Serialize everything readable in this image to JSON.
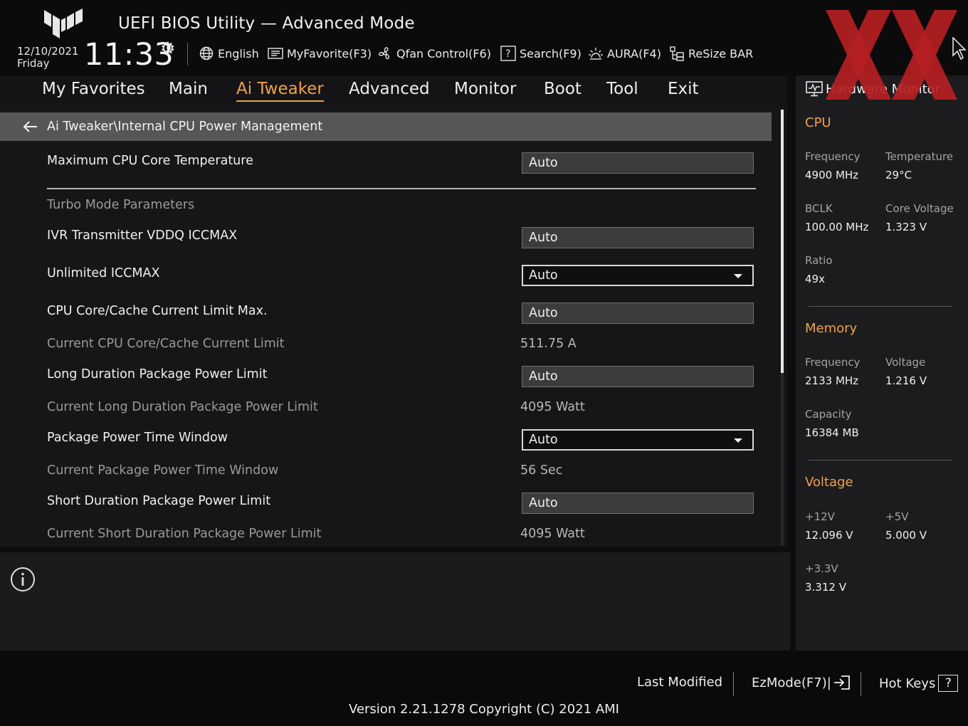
{
  "header": {
    "title": "UEFI BIOS Utility — Advanced Mode",
    "date": "12/10/2021",
    "day": "Friday",
    "time": "11:33",
    "toolbar": {
      "language": "English",
      "myfavorite": "MyFavorite(F3)",
      "qfan": "Qfan Control(F6)",
      "search": "Search(F9)",
      "aura": "AURA(F4)",
      "resizebar": "ReSize BAR"
    }
  },
  "nav": {
    "tabs": [
      "My Favorites",
      "Main",
      "Ai Tweaker",
      "Advanced",
      "Monitor",
      "Boot",
      "Tool",
      "Exit"
    ],
    "active": "Ai Tweaker"
  },
  "main": {
    "breadcrumb": "Ai Tweaker\\Internal CPU Power Management",
    "max_temp": {
      "label": "Maximum CPU Core Temperature",
      "value": "Auto"
    },
    "section_title": "Turbo Mode Parameters",
    "ivr": {
      "label": "IVR Transmitter VDDQ ICCMAX",
      "value": "Auto"
    },
    "unlimited_iccmax": {
      "label": "Unlimited ICCMAX",
      "value": "Auto"
    },
    "core_cache_limit": {
      "label": "CPU Core/Cache Current Limit Max.",
      "value": "Auto"
    },
    "current_core_cache_limit": {
      "label": "Current CPU Core/Cache Current Limit",
      "value": "511.75 A"
    },
    "long_duration": {
      "label": "Long Duration Package Power Limit",
      "value": "Auto"
    },
    "current_long_duration": {
      "label": "Current Long Duration Package Power Limit",
      "value": "4095 Watt"
    },
    "time_window": {
      "label": "Package Power Time Window",
      "value": "Auto"
    },
    "current_time_window": {
      "label": "Current Package Power Time Window",
      "value": "56 Sec"
    },
    "short_duration": {
      "label": "Short Duration Package Power Limit",
      "value": "Auto"
    },
    "current_short_duration": {
      "label": "Current Short Duration Package Power Limit",
      "value": "4095 Watt"
    }
  },
  "hardware_monitor": {
    "title": "Hardware Monitor",
    "cpu": {
      "heading": "CPU",
      "frequency_label": "Frequency",
      "frequency": "4900 MHz",
      "temperature_label": "Temperature",
      "temperature": "29°C",
      "bclk_label": "BCLK",
      "bclk": "100.00 MHz",
      "core_voltage_label": "Core Voltage",
      "core_voltage": "1.323 V",
      "ratio_label": "Ratio",
      "ratio": "49x"
    },
    "memory": {
      "heading": "Memory",
      "frequency_label": "Frequency",
      "frequency": "2133 MHz",
      "voltage_label": "Voltage",
      "voltage": "1.216 V",
      "capacity_label": "Capacity",
      "capacity": "16384 MB"
    },
    "voltage": {
      "heading": "Voltage",
      "v12_label": "+12V",
      "v12": "12.096 V",
      "v5_label": "+5V",
      "v5": "5.000 V",
      "v33_label": "+3.3V",
      "v33": "3.312 V"
    }
  },
  "footer": {
    "last_modified": "Last Modified",
    "ezmode": "EzMode(F7)|",
    "hotkeys": "Hot Keys",
    "hotkeys_key": "?",
    "version": "Version 2.21.1278 Copyright (C) 2021 AMI"
  },
  "colors": {
    "accent": "#f0a14a",
    "watermark": "#b51f23",
    "background": "#161618"
  },
  "icons": [
    "tuf-logo",
    "gear-icon",
    "globe-icon",
    "favorite-icon",
    "fan-icon",
    "search-icon",
    "aura-icon",
    "resize-bar-icon",
    "back-arrow-icon",
    "info-icon",
    "monitor-icon",
    "exit-ezmode-icon"
  ]
}
